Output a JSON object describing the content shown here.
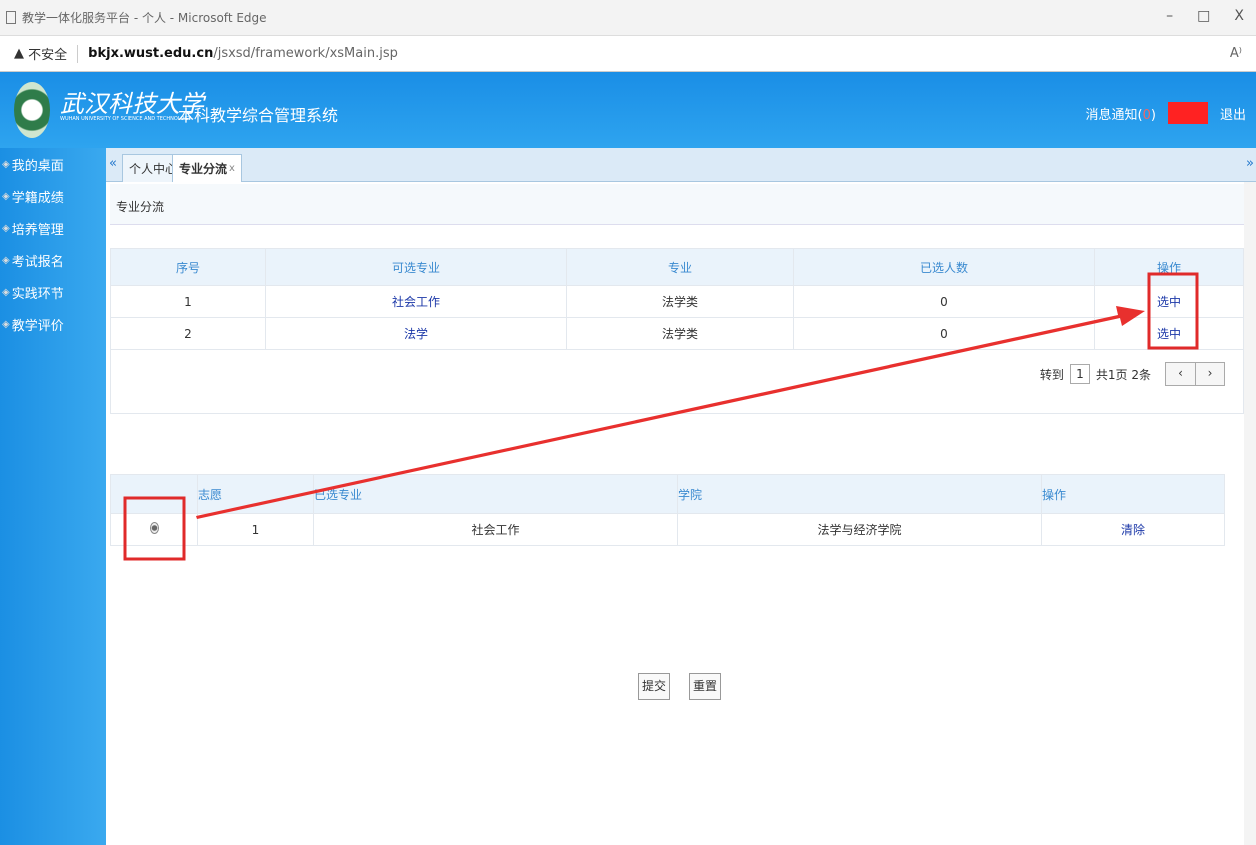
{
  "browser": {
    "title": "教学一体化服务平台 - 个人 - Microsoft Edge",
    "security": "不安全",
    "host": "bkjx.wust.edu.cn",
    "path": "/jsxsd/framework/xsMain.jsp",
    "minimize": "–",
    "maximize": "□",
    "close": "X",
    "read_aloud": "A⁾"
  },
  "header": {
    "university": "武汉科技大学",
    "university_en": "WUHAN UNIVERSITY OF SCIENCE AND TECHNOLOGY",
    "system_title": "本科教学综合管理系统",
    "messages_label": "消息通知(",
    "messages_count": "0",
    "messages_close": ")",
    "logout": "退出"
  },
  "sidebar": {
    "items": [
      {
        "label": "我的桌面"
      },
      {
        "label": "学籍成绩"
      },
      {
        "label": "培养管理"
      },
      {
        "label": "考试报名"
      },
      {
        "label": "实践环节"
      },
      {
        "label": "教学评价"
      }
    ]
  },
  "tabs": {
    "left_arrow": "«",
    "right_arrow": "»",
    "items": [
      {
        "label": "个人中心"
      },
      {
        "label": "专业分流",
        "close": "x"
      }
    ]
  },
  "breadcrumb": "专业分流",
  "available": {
    "headers": [
      "序号",
      "可选专业",
      "专业",
      "已选人数",
      "操作"
    ],
    "rows": [
      {
        "no": "1",
        "major": "社会工作",
        "category": "法学类",
        "count": "0",
        "action": "选中"
      },
      {
        "no": "2",
        "major": "法学",
        "category": "法学类",
        "count": "0",
        "action": "选中"
      }
    ]
  },
  "pager": {
    "goto": "转到",
    "page": "1",
    "summary": "共1页 2条",
    "prev": "‹",
    "next": "›"
  },
  "selected": {
    "headers": [
      "",
      "志愿",
      "已选专业",
      "学院",
      "操作"
    ],
    "rows": [
      {
        "preference": "1",
        "major": "社会工作",
        "college": "法学与经济学院",
        "action": "清除"
      }
    ]
  },
  "buttons": {
    "submit": "提交",
    "reset": "重置"
  },
  "colors": {
    "header_blue": "#1a8ee6",
    "link": "#1c38a8",
    "annotation_red": "#e02a2a"
  }
}
